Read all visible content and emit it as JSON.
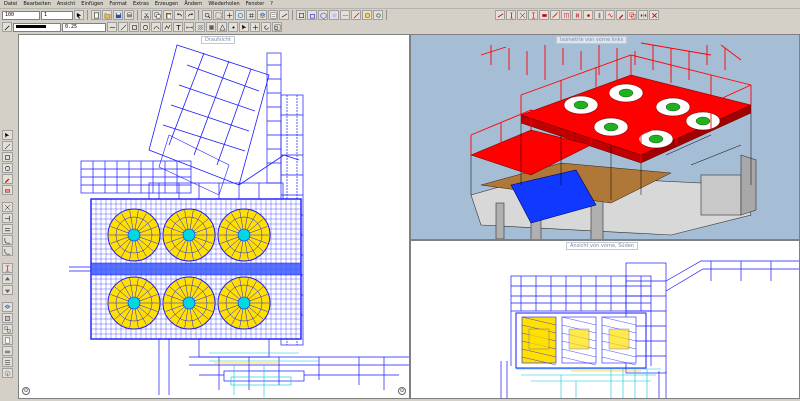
{
  "menu": [
    "Datei",
    "Bearbeiten",
    "Ansicht",
    "Einfügen",
    "Format",
    "Extras",
    "Erzeugen",
    "Ändern",
    "Wiederholen",
    "Fenster",
    "?"
  ],
  "toolbar": {
    "scale": "100",
    "layer": "1",
    "pen_width": "0.25"
  },
  "views": {
    "left_title": "Draufsicht",
    "top_right_title": "Isometrie von vorne links",
    "bottom_right_title": "Ansicht von vorne, Süden"
  },
  "colors": {
    "blueprint": "#1a1aff",
    "steel_red": "#ff0000",
    "fan_yellow": "#ffe000",
    "cyan": "#00d8e0",
    "floor_blue": "#1038ff"
  }
}
